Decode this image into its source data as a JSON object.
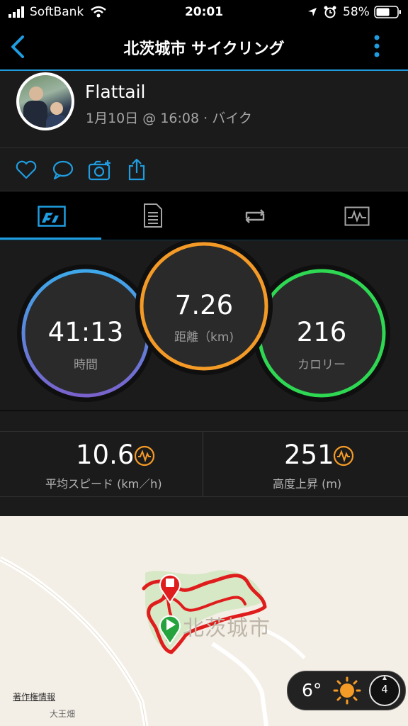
{
  "status_bar": {
    "carrier": "SoftBank",
    "time": "20:01",
    "battery": "58%"
  },
  "nav": {
    "title": "北茨城市 サイクリング"
  },
  "profile": {
    "name": "Flattail",
    "date": "1月10日 @ 16:08 · バイク"
  },
  "rings": [
    {
      "value": "41:13",
      "label": "時間",
      "color": "#4a9fe0"
    },
    {
      "value": "7.26",
      "label": "距離（km)",
      "color": "#f49a26"
    },
    {
      "value": "216",
      "label": "カロリー",
      "color": "#2ed852"
    }
  ],
  "stats": [
    {
      "value": "10.6",
      "label": "平均スピード (km／h)"
    },
    {
      "value": "251",
      "label": "高度上昇 (m)"
    }
  ],
  "map": {
    "place_label": "北茨城市",
    "credit": "著作権情報",
    "road_label": "大王畑"
  },
  "weather": {
    "temp": "6°",
    "wind": "4"
  },
  "colors": {
    "accent": "#1f9de0",
    "orange": "#f49a26",
    "route": "#e01d1d"
  }
}
